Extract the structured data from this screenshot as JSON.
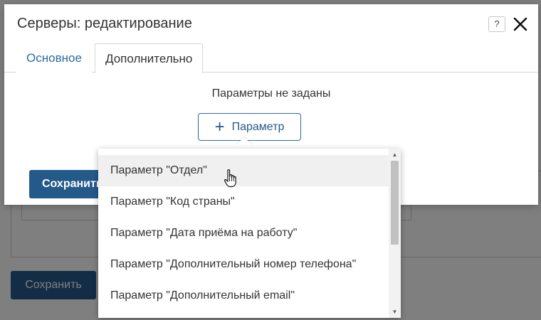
{
  "background": {
    "save_label": "Сохранить"
  },
  "dialog": {
    "title": "Серверы: редактирование",
    "help_label": "?",
    "tabs": [
      {
        "label": "Основное",
        "active": false
      },
      {
        "label": "Дополнительно",
        "active": true
      }
    ],
    "empty_text": "Параметры не заданы",
    "add_parameter_label": "Параметр",
    "save_label": "Сохранить"
  },
  "dropdown": {
    "items": [
      {
        "label": "Параметр \"Отдел\"",
        "hovered": true
      },
      {
        "label": "Параметр \"Код страны\""
      },
      {
        "label": "Параметр \"Дата приёма на работу\""
      },
      {
        "label": "Параметр \"Дополнительный номер телефона\""
      },
      {
        "label": "Параметр \"Дополнительный email\""
      }
    ],
    "scroll_up_glyph": "▲",
    "scroll_down_glyph": "▼"
  },
  "colors": {
    "accent": "#245a8a",
    "link": "#2d6aa1",
    "text": "#333333",
    "hover_row": "#f0f0f0"
  },
  "icons": [
    "close-icon",
    "help-icon",
    "plus-icon",
    "hand-cursor-icon"
  ]
}
